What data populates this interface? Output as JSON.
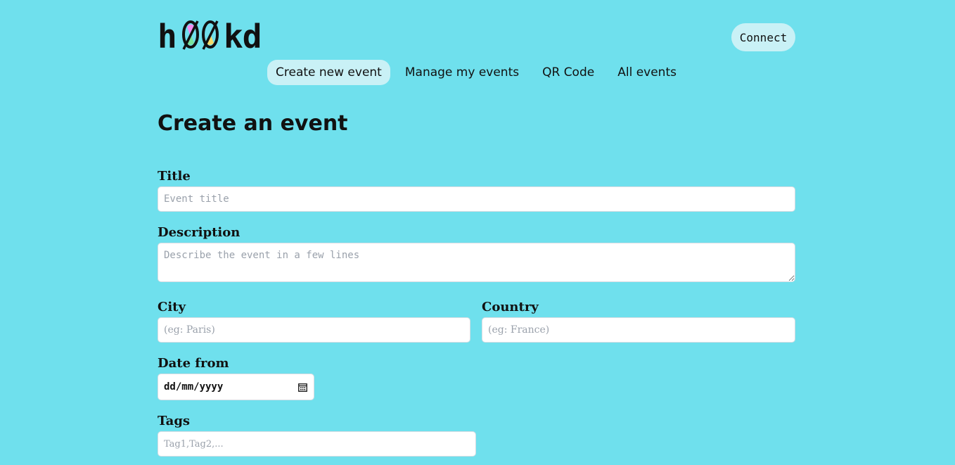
{
  "header": {
    "logo_text": "h00kd",
    "connect_label": "Connect"
  },
  "nav": {
    "items": [
      {
        "label": "Create new event"
      },
      {
        "label": "Manage my events"
      },
      {
        "label": "QR Code"
      },
      {
        "label": "All events"
      }
    ]
  },
  "form": {
    "heading": "Create an event",
    "title": {
      "label": "Title",
      "placeholder": "Event title",
      "value": ""
    },
    "description": {
      "label": "Description",
      "placeholder": "Describe the event in a few lines",
      "value": ""
    },
    "city": {
      "label": "City",
      "placeholder": "(eg: Paris)",
      "value": ""
    },
    "country": {
      "label": "Country",
      "placeholder": "(eg: France)",
      "value": ""
    },
    "date_from": {
      "label": "Date from",
      "display": "dd/mm/yyyy"
    },
    "tags": {
      "label": "Tags",
      "placeholder": "Tag1,Tag2,..."
    }
  },
  "colors": {
    "background": "#6fe0ed",
    "pill": "#c9f1f6",
    "logo_pink": "#f48cf0",
    "logo_green": "#7be39b",
    "logo_yellow": "#f5dc6a"
  }
}
